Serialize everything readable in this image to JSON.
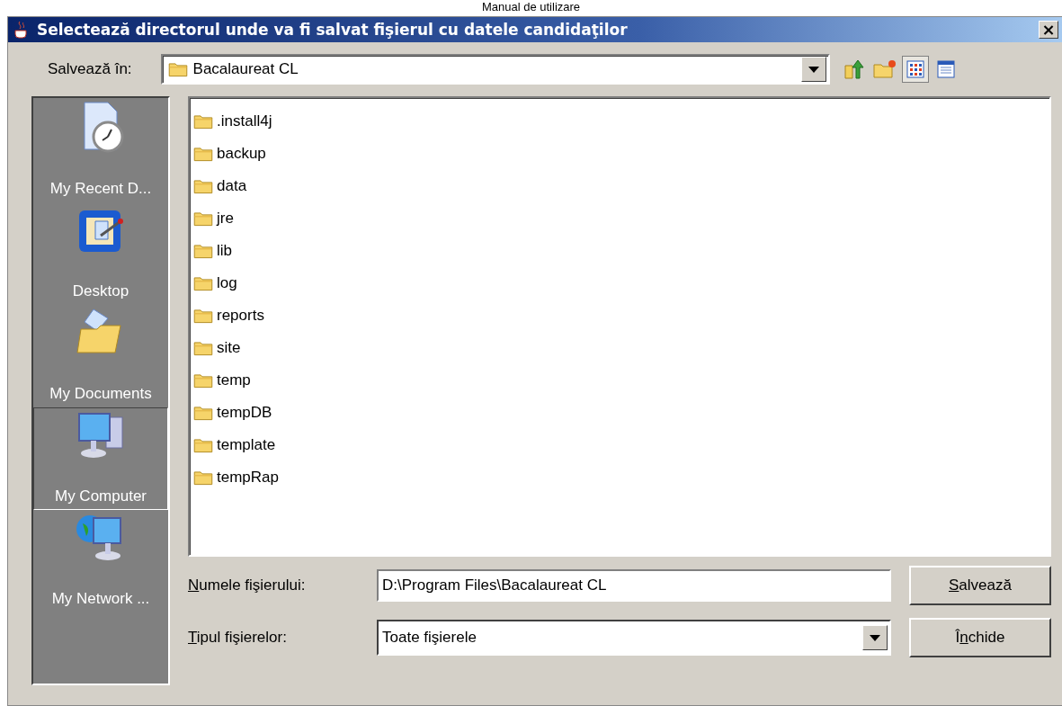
{
  "page_header": "Manual de utilizare",
  "window": {
    "title": "Selectează directorul unde va fi salvat fişierul cu datele candidaţilor",
    "close": "×"
  },
  "save_in": {
    "label": "Salvează în:",
    "value": "Bacalaureat CL"
  },
  "toolbar": [
    {
      "kind": "up",
      "selected": false
    },
    {
      "kind": "new-folder",
      "selected": false
    },
    {
      "kind": "list",
      "selected": true
    },
    {
      "kind": "details",
      "selected": false
    }
  ],
  "places": [
    {
      "kind": "recent",
      "label": "My Recent D...",
      "selected": false
    },
    {
      "kind": "desktop",
      "label": "Desktop",
      "selected": false
    },
    {
      "kind": "documents",
      "label": "My Documents",
      "selected": false
    },
    {
      "kind": "computer",
      "label": "My Computer",
      "selected": true
    },
    {
      "kind": "network",
      "label": "My Network ...",
      "selected": false
    }
  ],
  "files": [
    ".install4j",
    "backup",
    "data",
    "jre",
    "lib",
    "log",
    "reports",
    "site",
    "temp",
    "tempDB",
    "template",
    "tempRap"
  ],
  "file_name": {
    "label": {
      "key": "N",
      "rest": "umele fişierului:"
    },
    "value": "D:\\Program Files\\Bacalaureat CL"
  },
  "file_type": {
    "label": {
      "key": "T",
      "rest": "ipul fişierelor:"
    },
    "value": "Toate fişierele"
  },
  "buttons": [
    {
      "key": "S",
      "after": "alvează"
    },
    {
      "before": "Î",
      "key": "n",
      "after": "chide"
    }
  ]
}
